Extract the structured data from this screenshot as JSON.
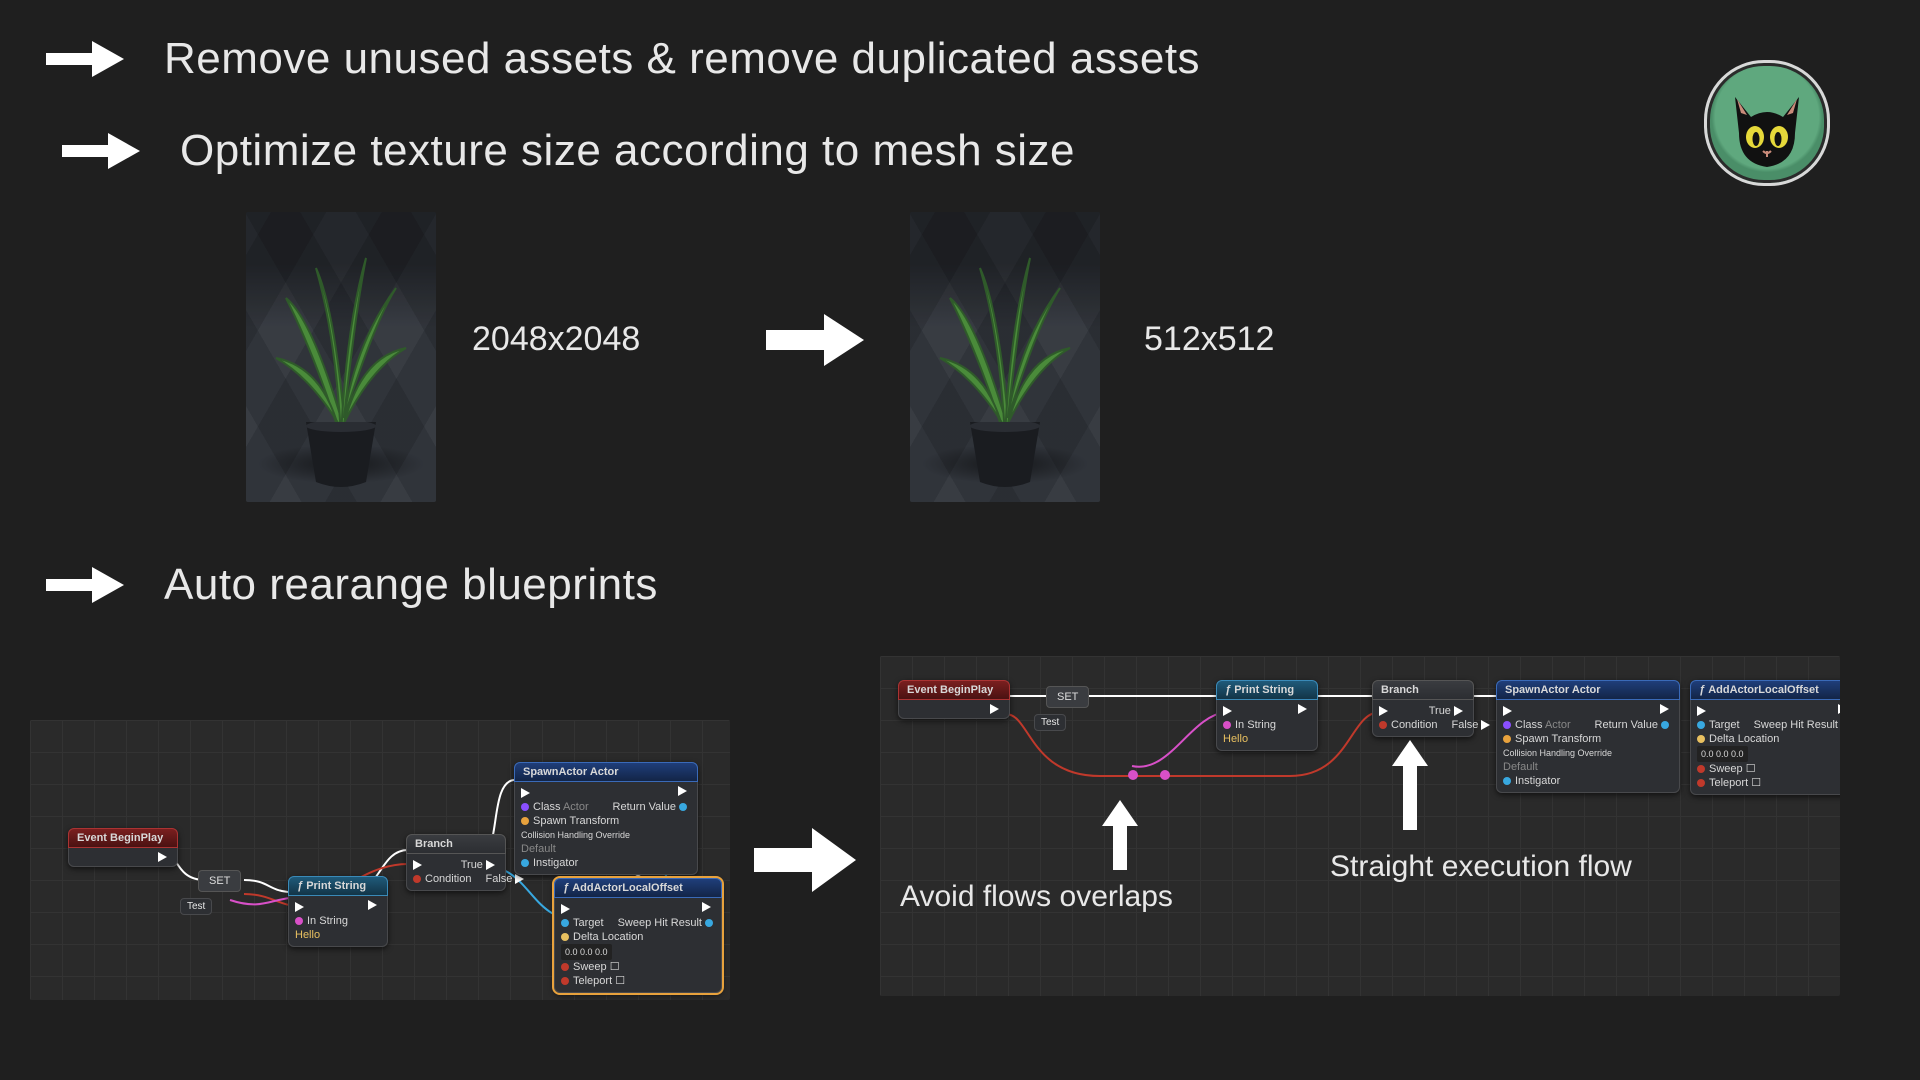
{
  "bullets": {
    "b1": "Remove unused assets & remove duplicated assets",
    "b2": "Optimize texture size according to mesh size",
    "b3": "Auto rearange blueprints"
  },
  "textures": {
    "large": "2048x2048",
    "small": "512x512"
  },
  "annotations": {
    "overlaps": "Avoid flows overlaps",
    "straight": "Straight execution flow"
  },
  "nodes": {
    "event_begin": "Event BeginPlay",
    "branch": "Branch",
    "print_string": "Print String",
    "spawn_actor": "SpawnActor Actor",
    "add_offset": "AddActorLocalOffset",
    "set": "SET",
    "pins": {
      "condition": "Condition",
      "true": "True",
      "false": "False",
      "class": "Class",
      "return_value": "Return Value",
      "spawn_transform": "Spawn Transform",
      "collision": "Collision Handling Override",
      "instigator": "Instigator",
      "default": "Default",
      "target": "Target",
      "delta": "Delta Location",
      "sweep": "Sweep",
      "teleport": "Teleport",
      "sweep_hit": "Sweep Hit Result",
      "in_string": "In String",
      "hello": "Hello",
      "test": "Test",
      "vec": "0.0   0.0   0.0",
      "actor_sel": "Actor"
    }
  }
}
